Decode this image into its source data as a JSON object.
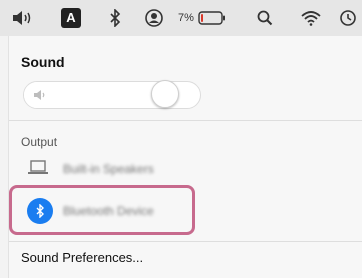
{
  "menubar": {
    "icons": [
      "volume-icon",
      "input-source-icon",
      "bluetooth-icon",
      "user-icon",
      "battery-icon",
      "search-icon",
      "wifi-icon",
      "time-machine-icon"
    ],
    "input_source": "A",
    "battery_percent": "7%",
    "battery_level": 0.07
  },
  "sound": {
    "title": "Sound",
    "volume_level": 0.85
  },
  "output": {
    "label": "Output",
    "devices": [
      {
        "name": "Built-in Speakers",
        "icon": "laptop-icon",
        "selected": false
      },
      {
        "name": "Bluetooth Device",
        "icon": "bluetooth-icon",
        "selected": true
      }
    ]
  },
  "menu": {
    "preferences_label": "Sound Preferences..."
  },
  "colors": {
    "accent": "#1a7df0",
    "highlight": "#c76a8d",
    "battery_low": "#d9392b"
  }
}
